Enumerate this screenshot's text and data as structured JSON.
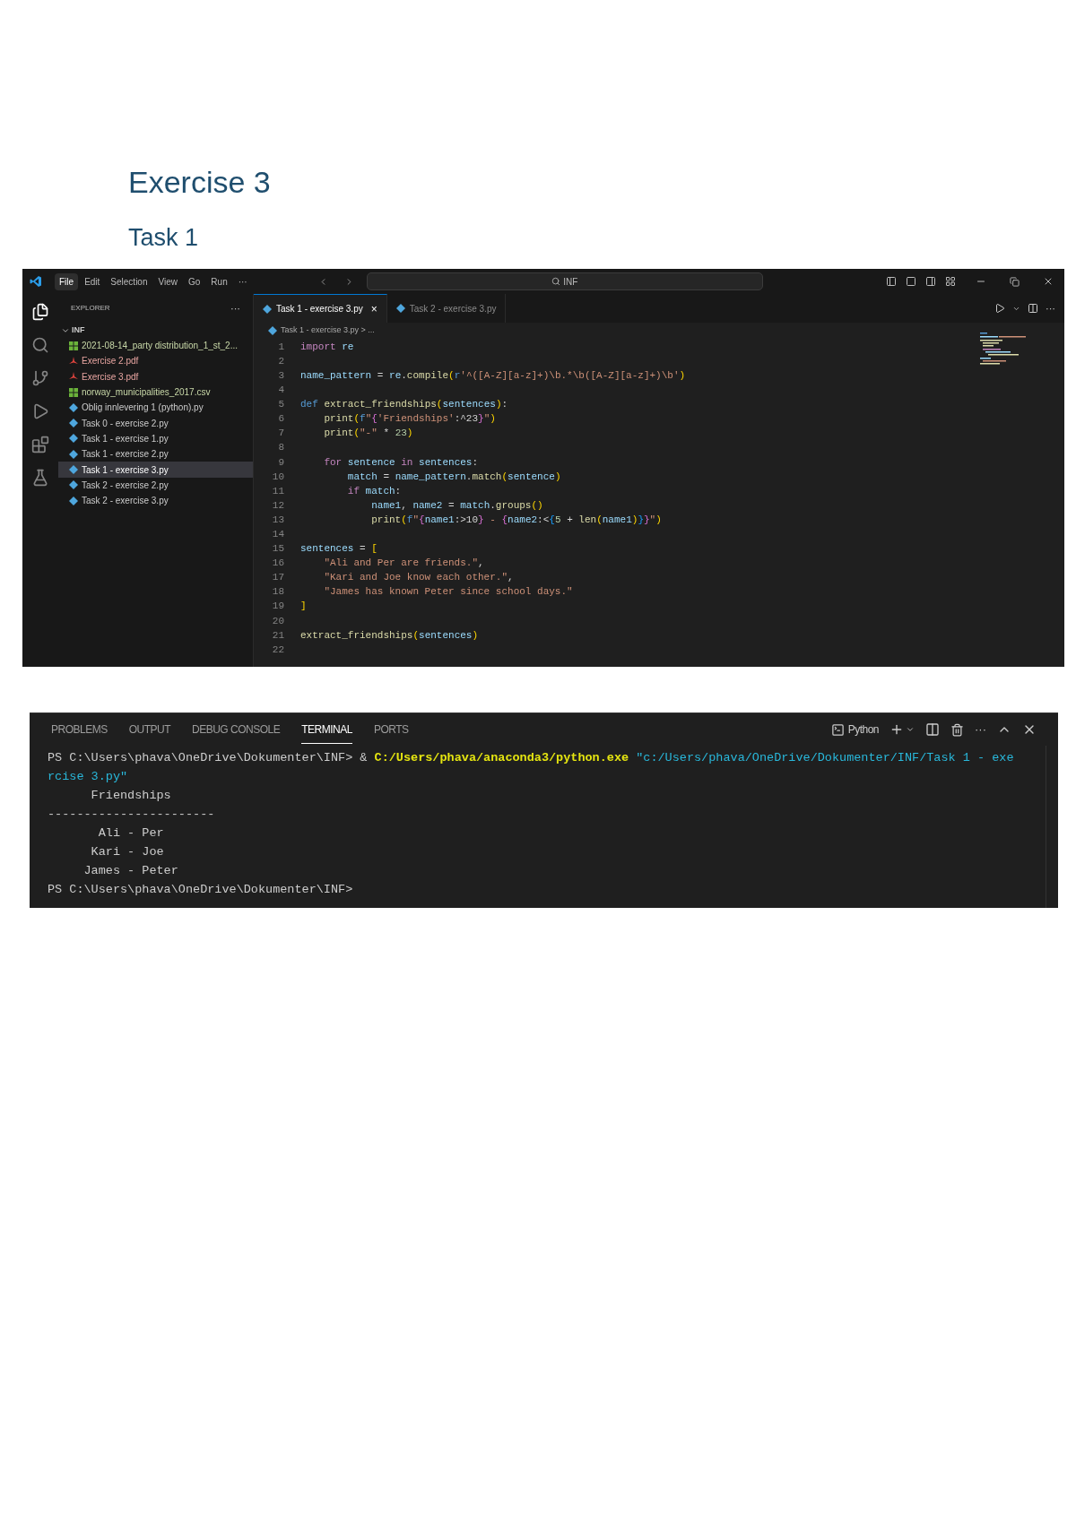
{
  "headings": {
    "title": "Exercise 3",
    "subtitle": "Task 1"
  },
  "editor_window": {
    "menu": [
      {
        "label": "File",
        "selected": true
      },
      {
        "label": "Edit",
        "selected": false
      },
      {
        "label": "Selection",
        "selected": false
      },
      {
        "label": "View",
        "selected": false
      },
      {
        "label": "Go",
        "selected": false
      },
      {
        "label": "Run",
        "selected": false
      },
      {
        "label": "···",
        "selected": false
      }
    ],
    "search": {
      "value": "INF"
    },
    "explorer": {
      "title": "EXPLORER",
      "more": "···",
      "folder": "INF",
      "files": [
        {
          "name": "2021-08-14_party distribution_1_st_2...",
          "kind": "csv",
          "selected": false
        },
        {
          "name": "Exercise 2.pdf",
          "kind": "pdf",
          "selected": false
        },
        {
          "name": "Exercise 3.pdf",
          "kind": "pdf",
          "selected": false
        },
        {
          "name": "norway_municipalities_2017.csv",
          "kind": "csv",
          "selected": false
        },
        {
          "name": "Oblig innlevering 1 (python).py",
          "kind": "py",
          "selected": false
        },
        {
          "name": "Task 0 - exercise 2.py",
          "kind": "py",
          "selected": false
        },
        {
          "name": "Task 1 - exercise 1.py",
          "kind": "py",
          "selected": false
        },
        {
          "name": "Task 1 - exercise 2.py",
          "kind": "py",
          "selected": false
        },
        {
          "name": "Task 1 - exercise 3.py",
          "kind": "py",
          "selected": true
        },
        {
          "name": "Task 2 - exercise 2.py",
          "kind": "py",
          "selected": false
        },
        {
          "name": "Task 2 - exercise 3.py",
          "kind": "py",
          "selected": false
        }
      ]
    },
    "tabs": [
      {
        "label": "Task 1 - exercise 3.py",
        "selected": true,
        "close": "×"
      },
      {
        "label": "Task 2 - exercise 3.py",
        "selected": false
      }
    ],
    "breadcrumb": "Task 1 - exercise 3.py > ...",
    "code": [
      {
        "n": "1",
        "tokens": [
          {
            "t": "import",
            "kind": "ctl"
          },
          {
            "t": " re",
            "kind": "var"
          }
        ]
      },
      {
        "n": "2"
      },
      {
        "n": "3",
        "tokens": [
          {
            "t": "name_pattern",
            "kind": "var"
          },
          {
            "t": " = ",
            "kind": "plain"
          },
          {
            "t": "re",
            "kind": "var"
          },
          {
            "t": ".",
            "kind": "plain"
          },
          {
            "t": "compile",
            "kind": "fn"
          },
          {
            "t": "(",
            "kind": "b1"
          },
          {
            "t": "r",
            "kind": "kw"
          },
          {
            "t": "'^([A-Z][a-z]+)\\b.*\\b([A-Z][a-z]+)\\b'",
            "kind": "str"
          },
          {
            "t": ")",
            "kind": "b1"
          }
        ]
      },
      {
        "n": "4"
      },
      {
        "n": "5",
        "tokens": [
          {
            "t": "def",
            "kind": "kw"
          },
          {
            "t": " extract_friendships",
            "kind": "fn"
          },
          {
            "t": "(",
            "kind": "b1"
          },
          {
            "t": "sentences",
            "kind": "var"
          },
          {
            "t": ")",
            "kind": "b1"
          },
          {
            "t": ":",
            "kind": "plain"
          }
        ],
        "children": [
          {
            "n": "6",
            "tokens": [
              {
                "t": "print",
                "kind": "fn"
              },
              {
                "t": "(",
                "kind": "b1"
              },
              {
                "t": "f",
                "kind": "kw"
              },
              {
                "t": "\"",
                "kind": "str"
              },
              {
                "t": "{",
                "kind": "b2"
              },
              {
                "t": "'Friendships'",
                "kind": "str"
              },
              {
                "t": ":^23",
                "kind": "plain"
              },
              {
                "t": "}",
                "kind": "b2"
              },
              {
                "t": "\"",
                "kind": "str"
              },
              {
                "t": ")",
                "kind": "b1"
              }
            ]
          },
          {
            "n": "7",
            "tokens": [
              {
                "t": "print",
                "kind": "fn"
              },
              {
                "t": "(",
                "kind": "b1"
              },
              {
                "t": "\"-\"",
                "kind": "str"
              },
              {
                "t": " * ",
                "kind": "plain"
              },
              {
                "t": "23",
                "kind": "num"
              },
              {
                "t": ")",
                "kind": "b1"
              }
            ]
          },
          {
            "n": "8"
          },
          {
            "n": "9",
            "tokens": [
              {
                "t": "for",
                "kind": "ctl"
              },
              {
                "t": " sentence",
                "kind": "var"
              },
              {
                "t": " in",
                "kind": "ctl"
              },
              {
                "t": " sentences",
                "kind": "var"
              },
              {
                "t": ":",
                "kind": "plain"
              }
            ],
            "children": [
              {
                "n": "10",
                "tokens": [
                  {
                    "t": "match",
                    "kind": "var"
                  },
                  {
                    "t": " = ",
                    "kind": "plain"
                  },
                  {
                    "t": "name_pattern",
                    "kind": "var"
                  },
                  {
                    "t": ".",
                    "kind": "plain"
                  },
                  {
                    "t": "match",
                    "kind": "fn"
                  },
                  {
                    "t": "(",
                    "kind": "b1"
                  },
                  {
                    "t": "sentence",
                    "kind": "var"
                  },
                  {
                    "t": ")",
                    "kind": "b1"
                  }
                ]
              },
              {
                "n": "11",
                "tokens": [
                  {
                    "t": "if",
                    "kind": "ctl"
                  },
                  {
                    "t": " match",
                    "kind": "var"
                  },
                  {
                    "t": ":",
                    "kind": "plain"
                  }
                ],
                "children": [
                  {
                    "n": "12",
                    "tokens": [
                      {
                        "t": "name1",
                        "kind": "var"
                      },
                      {
                        "t": ", ",
                        "kind": "plain"
                      },
                      {
                        "t": "name2",
                        "kind": "var"
                      },
                      {
                        "t": " = ",
                        "kind": "plain"
                      },
                      {
                        "t": "match",
                        "kind": "var"
                      },
                      {
                        "t": ".",
                        "kind": "plain"
                      },
                      {
                        "t": "groups",
                        "kind": "fn"
                      },
                      {
                        "t": "()",
                        "kind": "b1"
                      }
                    ]
                  },
                  {
                    "n": "13",
                    "tokens": [
                      {
                        "t": "print",
                        "kind": "fn"
                      },
                      {
                        "t": "(",
                        "kind": "b1"
                      },
                      {
                        "t": "f",
                        "kind": "kw"
                      },
                      {
                        "t": "\"",
                        "kind": "str"
                      },
                      {
                        "t": "{",
                        "kind": "b2"
                      },
                      {
                        "t": "name1",
                        "kind": "var"
                      },
                      {
                        "t": ":>10",
                        "kind": "plain"
                      },
                      {
                        "t": "}",
                        "kind": "b2"
                      },
                      {
                        "t": " - ",
                        "kind": "str"
                      },
                      {
                        "t": "{",
                        "kind": "b2"
                      },
                      {
                        "t": "name2",
                        "kind": "var"
                      },
                      {
                        "t": ":<",
                        "kind": "plain"
                      },
                      {
                        "t": "{",
                        "kind": "b3"
                      },
                      {
                        "t": "5",
                        "kind": "num"
                      },
                      {
                        "t": " + ",
                        "kind": "plain"
                      },
                      {
                        "t": "len",
                        "kind": "fn"
                      },
                      {
                        "t": "(",
                        "kind": "b1"
                      },
                      {
                        "t": "name1",
                        "kind": "var"
                      },
                      {
                        "t": ")",
                        "kind": "b1"
                      },
                      {
                        "t": "}",
                        "kind": "b3"
                      },
                      {
                        "t": "}",
                        "kind": "b2"
                      },
                      {
                        "t": "\"",
                        "kind": "str"
                      },
                      {
                        "t": ")",
                        "kind": "b1"
                      }
                    ]
                  }
                ]
              }
            ]
          }
        ]
      },
      {
        "n": "14"
      },
      {
        "n": "15",
        "tokens": [
          {
            "t": "sentences",
            "kind": "var"
          },
          {
            "t": " = ",
            "kind": "plain"
          },
          {
            "t": "[",
            "kind": "b1"
          }
        ],
        "children": [
          {
            "n": "16",
            "tokens": [
              {
                "t": "\"Ali and Per are friends.\"",
                "kind": "str"
              },
              {
                "t": ",",
                "kind": "plain"
              }
            ]
          },
          {
            "n": "17",
            "tokens": [
              {
                "t": "\"Kari and Joe know each other.\"",
                "kind": "str"
              },
              {
                "t": ",",
                "kind": "plain"
              }
            ]
          },
          {
            "n": "18",
            "tokens": [
              {
                "t": "\"James has known Peter since school days.\"",
                "kind": "str"
              }
            ]
          }
        ]
      },
      {
        "n": "19",
        "tokens": [
          {
            "t": "]",
            "kind": "b1"
          }
        ]
      },
      {
        "n": "20"
      },
      {
        "n": "21",
        "tokens": [
          {
            "t": "extract_friendships",
            "kind": "fn"
          },
          {
            "t": "(",
            "kind": "b1"
          },
          {
            "t": "sentences",
            "kind": "var"
          },
          {
            "t": ")",
            "kind": "b1"
          }
        ]
      },
      {
        "n": "22"
      }
    ]
  },
  "panel": {
    "tabs": [
      {
        "label": "PROBLEMS",
        "selected": false
      },
      {
        "label": "OUTPUT",
        "selected": false
      },
      {
        "label": "DEBUG CONSOLE",
        "selected": false
      },
      {
        "label": "TERMINAL",
        "selected": true
      },
      {
        "label": "PORTS",
        "selected": false
      }
    ],
    "shell": "Python",
    "more": "···",
    "terminal": [
      [
        {
          "t": "PS C:\\Users\\phava\\OneDrive\\Dokumenter\\INF> & ",
          "kind": "plain"
        },
        {
          "t": "C:/Users/phava/anaconda3/python.exe",
          "kind": "exe"
        },
        {
          "t": " \"c:/Users/phava/OneDrive/Dokumenter/INF/Task 1 - exe",
          "kind": "path"
        }
      ],
      [
        {
          "t": "rcise 3.py\"",
          "kind": "path"
        }
      ],
      [
        {
          "t": "      Friendships",
          "kind": "plain"
        }
      ],
      [
        {
          "t": "-----------------------",
          "kind": "plain"
        }
      ],
      [
        {
          "t": "       Ali - Per",
          "kind": "plain"
        }
      ],
      [
        {
          "t": "      Kari - Joe",
          "kind": "plain"
        }
      ],
      [
        {
          "t": "     James - Peter",
          "kind": "plain"
        }
      ],
      [
        {
          "t": "PS C:\\Users\\phava\\OneDrive\\Dokumenter\\INF>",
          "kind": "plain"
        }
      ]
    ]
  }
}
